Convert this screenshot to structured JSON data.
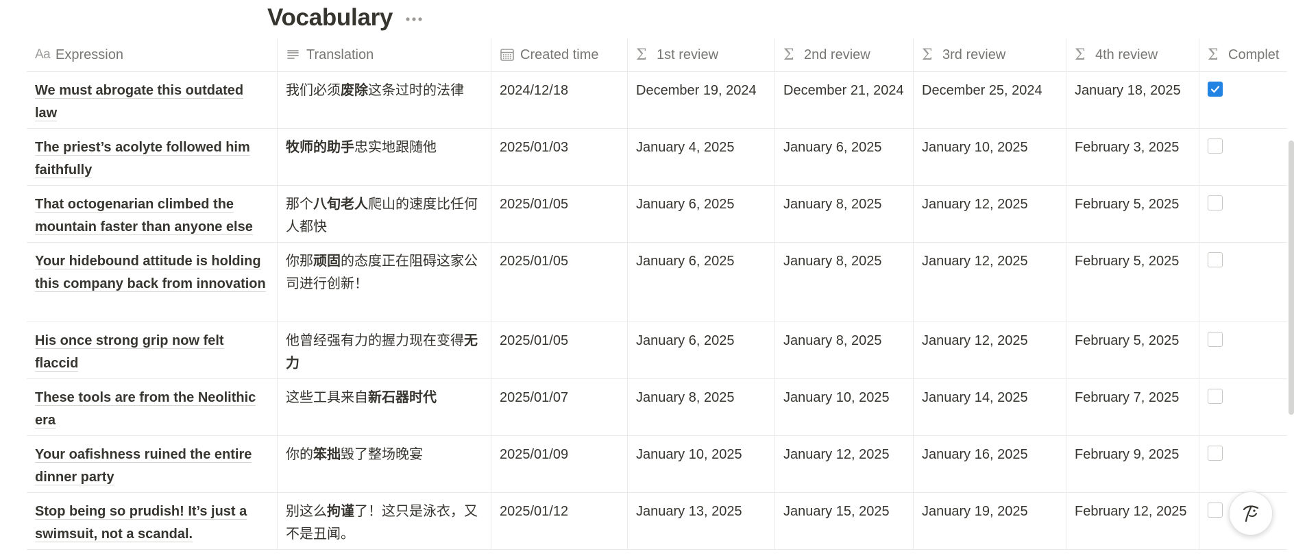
{
  "page": {
    "title": "Vocabulary"
  },
  "colors": {
    "accent": "#2383e2",
    "text": "#37352f",
    "muted": "#787774",
    "border": "#e9e9e7"
  },
  "columns": [
    {
      "label": "Expression",
      "icon": "title-property-icon"
    },
    {
      "label": "Translation",
      "icon": "text-property-icon"
    },
    {
      "label": "Created time",
      "icon": "calendar-icon"
    },
    {
      "label": "1st review",
      "icon": "formula-icon"
    },
    {
      "label": "2nd review",
      "icon": "formula-icon"
    },
    {
      "label": "3rd review",
      "icon": "formula-icon"
    },
    {
      "label": "4th review",
      "icon": "formula-icon"
    },
    {
      "label": "Complet",
      "icon": "formula-icon"
    }
  ],
  "rows": [
    {
      "expression": "We must abrogate this outdated law",
      "translation": [
        [
          "我们必须",
          0
        ],
        [
          "废除",
          1
        ],
        [
          "这条过时的法律",
          0
        ]
      ],
      "created": "2024/12/18",
      "r1": "December 19, 2024",
      "r2": "December 21, 2024",
      "r3": "December 25, 2024",
      "r4": "January 18, 2025",
      "complete": true
    },
    {
      "expression": "The priest’s acolyte followed him faithfully",
      "translation": [
        [
          "牧师的助手",
          1
        ],
        [
          "忠实地跟随他",
          0
        ]
      ],
      "created": "2025/01/03",
      "r1": "January 4, 2025",
      "r2": "January 6, 2025",
      "r3": "January 10, 2025",
      "r4": "February 3, 2025",
      "complete": false
    },
    {
      "expression": "That octogenarian climbed the mountain faster than anyone else",
      "translation": [
        [
          "那个",
          0
        ],
        [
          "八旬老人",
          1
        ],
        [
          "爬山的速度比任何人都快",
          0
        ]
      ],
      "created": "2025/01/05",
      "r1": "January 6, 2025",
      "r2": "January 8, 2025",
      "r3": "January 12, 2025",
      "r4": "February 5, 2025",
      "complete": false
    },
    {
      "expression": "Your hidebound attitude is holding this company back from innovation",
      "translation": [
        [
          "你那",
          0
        ],
        [
          "顽固",
          1
        ],
        [
          "的态度正在阻碍这家公司进行创新！",
          0
        ]
      ],
      "created": "2025/01/05",
      "r1": "January 6, 2025",
      "r2": "January 8, 2025",
      "r3": "January 12, 2025",
      "r4": "February 5, 2025",
      "complete": false
    },
    {
      "expression": "His once strong grip now felt flaccid",
      "translation": [
        [
          "他曾经强有力的握力现在变得",
          0
        ],
        [
          "无力",
          1
        ]
      ],
      "created": "2025/01/05",
      "r1": "January 6, 2025",
      "r2": "January 8, 2025",
      "r3": "January 12, 2025",
      "r4": "February 5, 2025",
      "complete": false
    },
    {
      "expression": "These tools are from the Neolithic era",
      "translation": [
        [
          "这些工具来自",
          0
        ],
        [
          "新石器时代",
          1
        ]
      ],
      "created": "2025/01/07",
      "r1": "January 8, 2025",
      "r2": "January 10, 2025",
      "r3": "January 14, 2025",
      "r4": "February 7, 2025",
      "complete": false
    },
    {
      "expression": "Your oafishness ruined the entire dinner party",
      "translation": [
        [
          "你的",
          0
        ],
        [
          "笨拙",
          1
        ],
        [
          "毁了整场晚宴",
          0
        ]
      ],
      "created": "2025/01/09",
      "r1": "January 10, 2025",
      "r2": "January 12, 2025",
      "r3": "January 16, 2025",
      "r4": "February 9, 2025",
      "complete": false
    },
    {
      "expression": "Stop being so prudish! It’s just a swimsuit, not a scandal.",
      "translation": [
        [
          "别这么",
          0
        ],
        [
          "拘谨",
          1
        ],
        [
          "了！这只是泳衣，又不是丑闻。",
          0
        ]
      ],
      "created": "2025/01/12",
      "r1": "January 13, 2025",
      "r2": "January 15, 2025",
      "r3": "January 19, 2025",
      "r4": "February 12, 2025",
      "complete": false
    }
  ]
}
